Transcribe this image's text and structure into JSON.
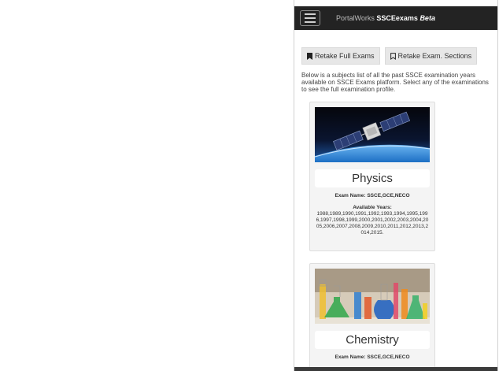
{
  "navbar": {
    "brand_prefix": "PortalWorks",
    "brand_name": "SSCEexams",
    "brand_tag": "Beta"
  },
  "actions": {
    "retake_full": "Retake Full Exams",
    "retake_sections": "Retake Exam. Sections"
  },
  "intro": "Below is a subjects list of all the past SSCE examination years available on SSCE Exams platform. Select any of the examinations to see the full examination profile.",
  "subjects": [
    {
      "name": "Physics",
      "exam_name_label": "Exam Name:",
      "exam_name": "SSCE,GCE,NECO",
      "years_label": "Available Years:",
      "years": "1988,1989,1990,1991,1992,1993,1994,1995,1996,1997,1998,1999,2000,2001,2002,2003,2004,2005,2006,2007,2008,2009,2010,2011,2012,2013,2014,2015."
    },
    {
      "name": "Chemistry",
      "exam_name_label": "Exam Name:",
      "exam_name": "SSCE,GCE,NECO"
    }
  ],
  "icons": [
    "menu-icon",
    "bookmark-icon",
    "bookmark-outline-icon"
  ],
  "colors": {
    "navbar": "#232323",
    "button": "#e7e7e7",
    "card": "#f4f4f4"
  }
}
